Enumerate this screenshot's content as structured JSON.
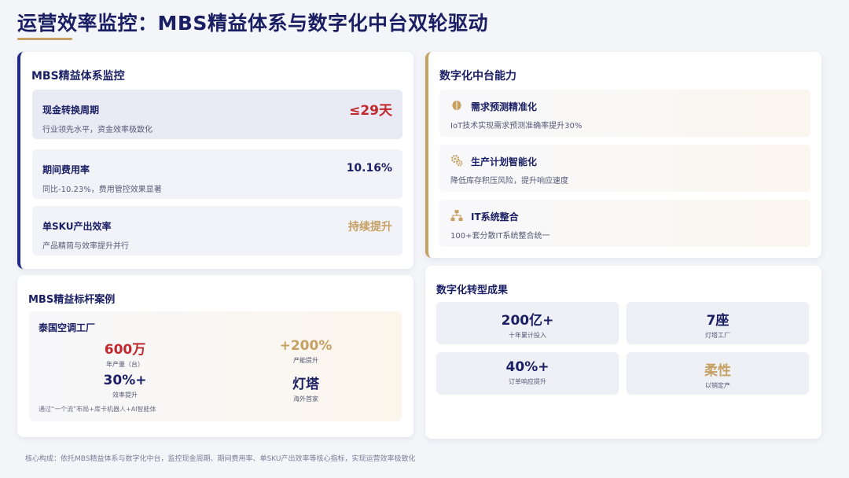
{
  "header": {
    "title": "运营效率监控：MBS精益体系与数字化中台双轮驱动"
  },
  "mbs": {
    "title": "MBS精益体系监控",
    "metrics": [
      {
        "label": "现金转换周期",
        "value": "≤29天",
        "desc": "行业领先水平，资金效率极致化"
      },
      {
        "label": "期间费用率",
        "value": "10.16%",
        "desc": "同比-10.23%，费用管控效果显著"
      },
      {
        "label": "单SKU产出效率",
        "value": "持续提升",
        "desc": "产品精简与效率提升并行"
      }
    ]
  },
  "digital": {
    "title": "数字化中台能力",
    "capabilities": [
      {
        "icon": "brain-icon",
        "label": "需求预测精准化",
        "desc": "IoT技术实现需求预测准确率提升30%"
      },
      {
        "icon": "gears-icon",
        "label": "生产计划智能化",
        "desc": "降低库存积压风险，提升响应速度"
      },
      {
        "icon": "network-icon",
        "label": "IT系统整合",
        "desc": "100+套分散IT系统整合统一"
      }
    ]
  },
  "bench": {
    "title": "MBS精益标杆案例",
    "name": "泰国空调工厂",
    "stats": [
      {
        "value": "600万",
        "label": "年产量（台）"
      },
      {
        "value": "+200%",
        "label": "产能提升"
      },
      {
        "value": "30%+",
        "label": "效率提升"
      },
      {
        "value": "灯塔",
        "label": "海外首家"
      }
    ],
    "note": "通过“一个流”布局+库卡机器人+AI智能体"
  },
  "results": {
    "title": "数字化转型成果",
    "items": [
      {
        "value": "200亿+",
        "label": "十年累计投入"
      },
      {
        "value": "7座",
        "label": "灯塔工厂"
      },
      {
        "value": "40%+",
        "label": "订单响应提升"
      },
      {
        "value": "柔性",
        "label": "以销定产"
      }
    ]
  },
  "footer": {
    "text": "核心构成：依托MBS精益体系与数字化中台，监控现金周期、期间费用率、单SKU产出效率等核心指标，实现运营效率极致化"
  },
  "colors": {
    "navy": "#1a1f64",
    "red": "#c0282d",
    "gold": "#c7a064"
  }
}
